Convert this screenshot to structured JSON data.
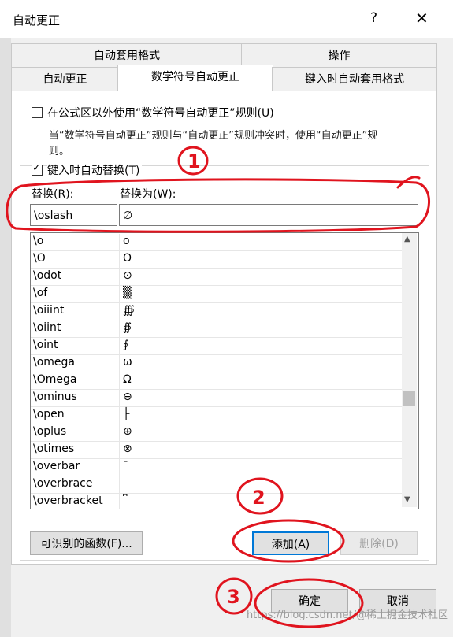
{
  "window": {
    "title": "自动更正",
    "help_glyph": "?",
    "close_glyph": "✕"
  },
  "tabs": {
    "row1": [
      "自动套用格式",
      "操作"
    ],
    "row2": [
      "自动更正",
      "数学符号自动更正",
      "键入时自动套用格式"
    ]
  },
  "options": {
    "outside_label": "在公式区以外使用“数学符号自动更正”规则(U)",
    "outside_checked": false,
    "conflict_note_1": "当“数学符号自动更正”规则与“自动更正”规则冲突时，使用“自动更正”规",
    "conflict_note_2": "则。",
    "replace_label": "键入时自动替换(T)",
    "replace_checked": true
  },
  "fields": {
    "replace_label": "替换(R):",
    "with_label": "替换为(W):",
    "replace_value": "\\oslash",
    "with_value": "∅"
  },
  "list": {
    "rows": [
      {
        "name": "\\o",
        "symbol": "ο"
      },
      {
        "name": "\\O",
        "symbol": "Ο"
      },
      {
        "name": "\\odot",
        "symbol": "⊙"
      },
      {
        "name": "\\of",
        "symbol": "▒"
      },
      {
        "name": "\\oiiint",
        "symbol": "∰"
      },
      {
        "name": "\\oiint",
        "symbol": "∯"
      },
      {
        "name": "\\oint",
        "symbol": "∮"
      },
      {
        "name": "\\omega",
        "symbol": "ω"
      },
      {
        "name": "\\Omega",
        "symbol": "Ω"
      },
      {
        "name": "\\ominus",
        "symbol": "⊖"
      },
      {
        "name": "\\open",
        "symbol": "├"
      },
      {
        "name": "\\oplus",
        "symbol": "⊕"
      },
      {
        "name": "\\otimes",
        "symbol": "⊗"
      },
      {
        "name": "\\overbar",
        "symbol": "¯"
      },
      {
        "name": "\\overbrace",
        "symbol": ""
      },
      {
        "name": "\\overbracket",
        "symbol": "⎴"
      }
    ]
  },
  "buttons": {
    "functions": "可识别的函数(F)...",
    "add": "添加(A)",
    "delete": "删除(D)",
    "ok": "确定",
    "cancel": "取消"
  },
  "annotations": {
    "one": "1",
    "two": "2",
    "three": "3"
  },
  "watermark": "https://blog.csdn.net/@稀土掘金技术社区"
}
